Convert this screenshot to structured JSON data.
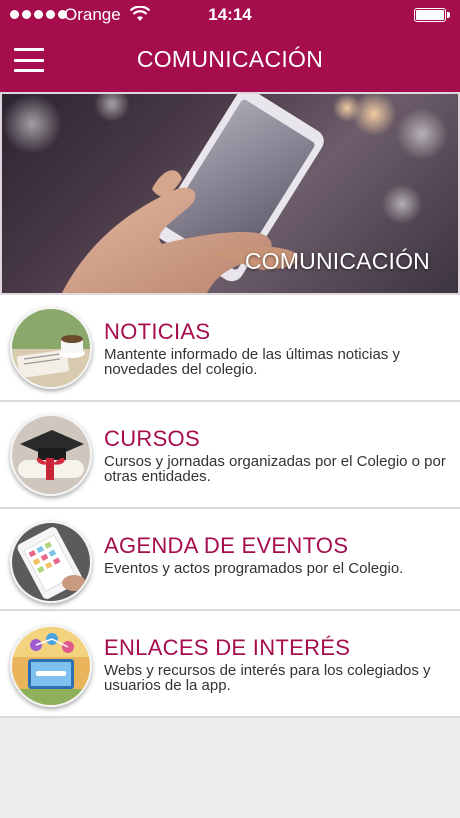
{
  "status": {
    "carrier": "Orange",
    "time": "14:14"
  },
  "nav": {
    "title": "COMUNICACIÓN"
  },
  "hero": {
    "caption": "COMUNICACIÓN"
  },
  "colors": {
    "brand": "#a50d4c",
    "title_text": "#a50d4c",
    "background": "#ececec"
  },
  "items": [
    {
      "title": "NOTICIAS",
      "description": "Mantente informado de las últimas noticias y novedades del colegio.",
      "icon": "newspaper-coffee-icon"
    },
    {
      "title": "CURSOS",
      "description": "Cursos y jornadas organizadas por el Colegio o por otras entidades.",
      "icon": "graduation-cap-icon"
    },
    {
      "title": "AGENDA DE EVENTOS",
      "description": "Eventos y actos programados por el Colegio.",
      "icon": "calendar-tablet-icon"
    },
    {
      "title": "ENLACES DE INTERÉS",
      "description": "Webs y recursos de interés para los colegiados y usuarios de la app.",
      "icon": "network-links-icon"
    }
  ]
}
